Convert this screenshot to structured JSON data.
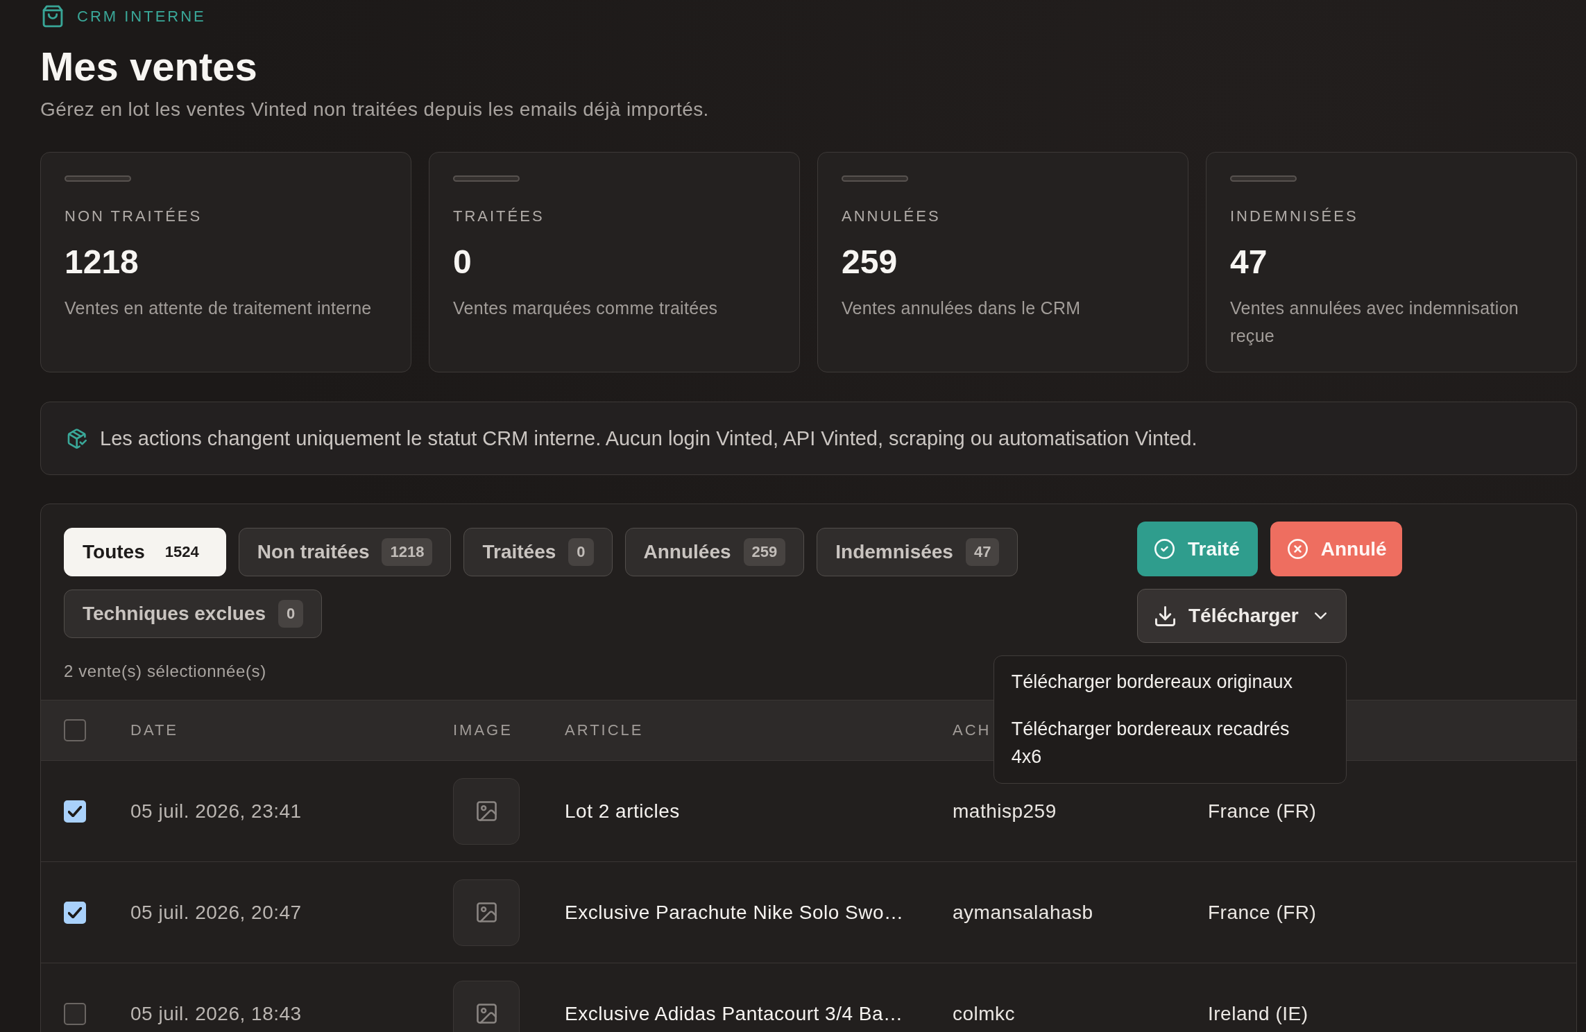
{
  "header": {
    "brand": "CRM INTERNE",
    "title": "Mes ventes",
    "subtitle": "Gérez en lot les ventes Vinted non traitées depuis les emails déjà importés."
  },
  "stats": [
    {
      "label": "NON TRAITÉES",
      "value": "1218",
      "description": "Ventes en attente de traitement interne"
    },
    {
      "label": "TRAITÉES",
      "value": "0",
      "description": "Ventes marquées comme traitées"
    },
    {
      "label": "ANNULÉES",
      "value": "259",
      "description": "Ventes annulées dans le CRM"
    },
    {
      "label": "INDEMNISÉES",
      "value": "47",
      "description": "Ventes annulées avec indemnisation reçue"
    }
  ],
  "notice": {
    "text": "Les actions changent uniquement le statut CRM interne. Aucun login Vinted, API Vinted, scraping ou automatisation Vinted."
  },
  "filters": [
    {
      "label": "Toutes",
      "count": "1524",
      "selected": true
    },
    {
      "label": "Non traitées",
      "count": "1218",
      "selected": false
    },
    {
      "label": "Traitées",
      "count": "0",
      "selected": false
    },
    {
      "label": "Annulées",
      "count": "259",
      "selected": false
    },
    {
      "label": "Indemnisées",
      "count": "47",
      "selected": false
    },
    {
      "label": "Techniques exclues",
      "count": "0",
      "selected": false
    }
  ],
  "actions": [
    {
      "label": "Traité",
      "kind": "confirm"
    },
    {
      "label": "Annulé",
      "kind": "cancel"
    },
    {
      "label": "Télécharger",
      "kind": "menu"
    }
  ],
  "download_menu": {
    "open": true,
    "items": [
      "Télécharger bordereaux originaux",
      "Télécharger bordereaux recadrés 4x6"
    ]
  },
  "selection_count": "2 vente(s) sélectionnée(s)",
  "table": {
    "select_all_checked": false,
    "columns": [
      "DATE",
      "IMAGE",
      "ARTICLE",
      "ACH"
    ],
    "rows": [
      {
        "checked": true,
        "date": "05 juil. 2026, 23:41",
        "article": "Lot 2 articles",
        "buyer": "mathisp259",
        "country": "France (FR)"
      },
      {
        "checked": true,
        "date": "05 juil. 2026, 20:47",
        "article": "Exclusive Parachute Nike Solo Swo…",
        "buyer": "aymansalahasb",
        "country": "France (FR)"
      },
      {
        "checked": false,
        "date": "05 juil. 2026, 18:43",
        "article": "Exclusive Adidas Pantacourt 3/4 Ba…",
        "buyer": "colmkc",
        "country": "Ireland (IE)"
      }
    ]
  }
}
